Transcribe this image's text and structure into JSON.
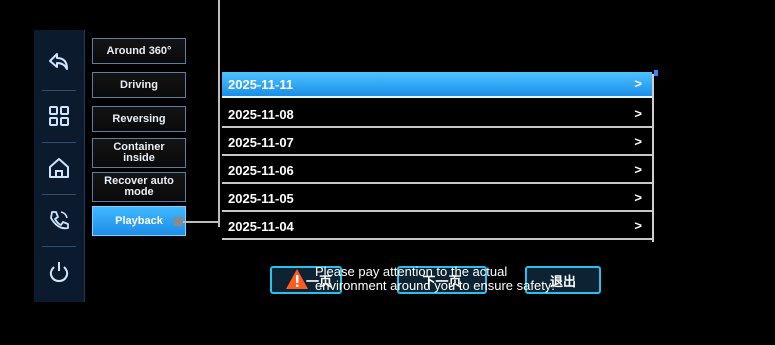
{
  "rail": {
    "items": [
      {
        "icon": "back-icon"
      },
      {
        "icon": "grid-icon"
      },
      {
        "icon": "home-icon"
      },
      {
        "icon": "phone-icon"
      },
      {
        "icon": "power-icon"
      }
    ]
  },
  "modes": [
    {
      "label": "Around 360°",
      "active": false
    },
    {
      "label": "Driving",
      "active": false
    },
    {
      "label": "Reversing",
      "active": false
    },
    {
      "label": "Container inside",
      "active": false
    },
    {
      "label": "Recover auto mode",
      "active": false
    },
    {
      "label": "Playback",
      "active": true
    }
  ],
  "playback": {
    "dates": [
      {
        "date": "2025-11-11",
        "arrow": ">",
        "selected": true
      },
      {
        "date": "2025-11-08",
        "arrow": ">",
        "selected": false
      },
      {
        "date": "2025-11-07",
        "arrow": ">",
        "selected": false
      },
      {
        "date": "2025-11-06",
        "arrow": ">",
        "selected": false
      },
      {
        "date": "2025-11-05",
        "arrow": ">",
        "selected": false
      },
      {
        "date": "2025-11-04",
        "arrow": ">",
        "selected": false
      }
    ]
  },
  "footer": {
    "btn1": "一页",
    "btn2": "下一页",
    "btn3": "退出",
    "warning_line1": "Please pay attention to the actual",
    "warning_line2": "environment around you to ensure safety!"
  },
  "colors": {
    "accent": "#29c0f0",
    "selected": "#1a8ee8",
    "warning": "#ff5a1f"
  }
}
